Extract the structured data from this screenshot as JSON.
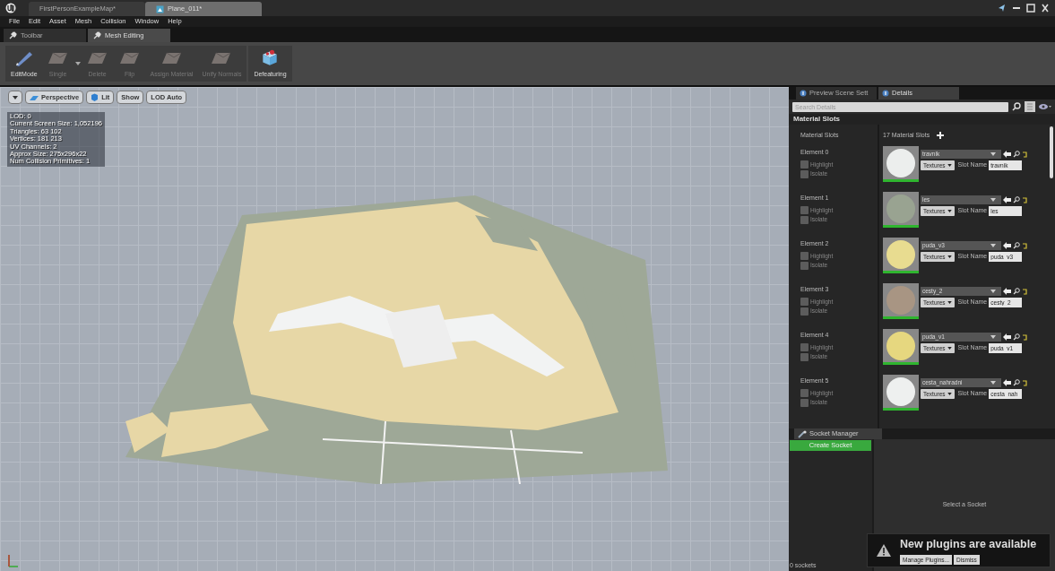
{
  "window": {
    "tabs": [
      {
        "label": "FirstPersonExampleMap*",
        "selected": false
      },
      {
        "label": "Plane_011*",
        "selected": true
      }
    ]
  },
  "menu": [
    "File",
    "Edit",
    "Asset",
    "Mesh",
    "Collision",
    "Window",
    "Help"
  ],
  "panel_tabs": [
    {
      "label": "Toolbar",
      "selected": false
    },
    {
      "label": "Mesh Editing",
      "selected": true
    }
  ],
  "toolbar": [
    {
      "label": "EditMode",
      "kind": "pencil",
      "disabled": false,
      "dropdown": false
    },
    {
      "label": "Single",
      "kind": "sheet",
      "disabled": true,
      "dropdown": true
    },
    {
      "label": "Delete",
      "kind": "sheet",
      "disabled": true,
      "dropdown": false
    },
    {
      "label": "Flip",
      "kind": "sheet",
      "disabled": true,
      "dropdown": false
    },
    {
      "label": "Assign Material",
      "kind": "sheet",
      "disabled": true,
      "dropdown": false
    },
    {
      "label": "Unify Normals",
      "kind": "sheet",
      "disabled": true,
      "dropdown": false
    },
    {
      "label": "Defeaturing",
      "kind": "cube",
      "disabled": false,
      "dropdown": false
    }
  ],
  "viewport": {
    "buttons": [
      {
        "kind": "caret"
      },
      {
        "kind": "perspective",
        "label": "Perspective"
      },
      {
        "kind": "lit",
        "label": "Lit"
      },
      {
        "kind": "plain",
        "label": "Show"
      },
      {
        "kind": "plain",
        "label": "LOD Auto"
      }
    ],
    "stats": [
      "LOD: 0",
      "Current Screen Size: 1,052196",
      "Triangles: 63 102",
      "Vertices: 181 213",
      "UV Channels: 2",
      "Approx Size: 275x296x22",
      "Num Collision Primitives: 1"
    ]
  },
  "details": {
    "tabs": [
      {
        "label": "Preview Scene Sett",
        "selected": false
      },
      {
        "label": "Details",
        "selected": true
      }
    ],
    "search": {
      "placeholder": "Search Details"
    },
    "section": "Material Slots",
    "slots_label": "Material Slots",
    "slots_count": "17 Material Slots",
    "elements": [
      {
        "label": "Element 0",
        "highlight": {
          "label": "Highlight",
          "checked": false
        },
        "isolate": {
          "label": "Isolate",
          "checked": false
        },
        "material": "travnik",
        "color": "#eceeed",
        "textures": "Textures",
        "slot_label": "Slot Name",
        "slot_name": "travnik"
      },
      {
        "label": "Element 1",
        "highlight": {
          "label": "Highlight",
          "checked": false
        },
        "isolate": {
          "label": "Isolate",
          "checked": false
        },
        "material": "les",
        "color": "#99a391",
        "textures": "Textures",
        "slot_label": "Slot Name",
        "slot_name": "les"
      },
      {
        "label": "Element 2",
        "highlight": {
          "label": "Highlight",
          "checked": false
        },
        "isolate": {
          "label": "Isolate",
          "checked": false
        },
        "material": "puda_v3",
        "color": "#e8dc90",
        "textures": "Textures",
        "slot_label": "Slot Name",
        "slot_name": "puda_v3"
      },
      {
        "label": "Element 3",
        "highlight": {
          "label": "Highlight",
          "checked": false
        },
        "isolate": {
          "label": "Isolate",
          "checked": false
        },
        "material": "cesty_2",
        "color": "#a89583",
        "textures": "Textures",
        "slot_label": "Slot Name",
        "slot_name": "cesty_2"
      },
      {
        "label": "Element 4",
        "highlight": {
          "label": "Highlight",
          "checked": false
        },
        "isolate": {
          "label": "Isolate",
          "checked": false
        },
        "material": "puda_v1",
        "color": "#e6d77f",
        "textures": "Textures",
        "slot_label": "Slot Name",
        "slot_name": "puda_v1"
      },
      {
        "label": "Element 5",
        "highlight": {
          "label": "Highlight",
          "checked": false
        },
        "isolate": {
          "label": "Isolate",
          "checked": false
        },
        "material": "cesta_nahradni",
        "color": "#eef0ef",
        "textures": "Textures",
        "slot_label": "Slot Name",
        "slot_name": "cesta_nah"
      }
    ]
  },
  "socket_manager": {
    "tab": "Socket Manager",
    "create_button": "Create Socket",
    "empty_text": "Select a Socket",
    "count": "0 sockets"
  },
  "notification": {
    "message": "New plugins are available",
    "buttons": [
      "Manage Plugins...",
      "Dismiss"
    ]
  }
}
